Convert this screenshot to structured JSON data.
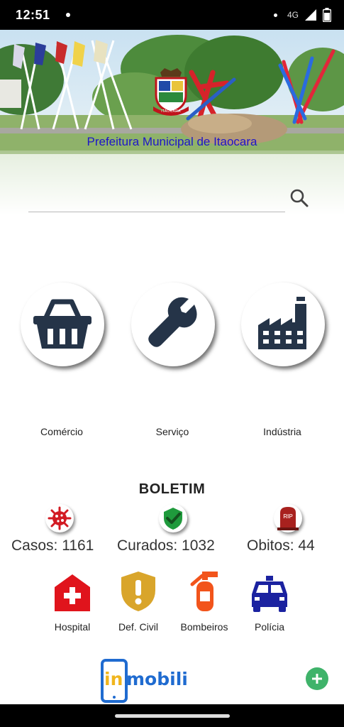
{
  "status": {
    "time": "12:51",
    "network": "4G"
  },
  "header": {
    "title": "Prefeitura Municipal de Itaocara",
    "seal_text": "ITAOCARA"
  },
  "search": {
    "placeholder": ""
  },
  "categories": [
    {
      "label": "Comércio",
      "icon": "basket-icon"
    },
    {
      "label": "Serviço",
      "icon": "wrench-icon"
    },
    {
      "label": "Indústria",
      "icon": "factory-icon"
    }
  ],
  "boletim": {
    "title": "BOLETIM",
    "casos": "Casos: 1161",
    "curados": "Curados: 1032",
    "obitos": "Obitos: 44",
    "rip_text": "RIP"
  },
  "services": [
    {
      "label": "Hospital",
      "icon": "hospital-icon"
    },
    {
      "label": "Def. Civil",
      "icon": "shield-alert-icon"
    },
    {
      "label": "Bombeiros",
      "icon": "fire-extinguisher-icon"
    },
    {
      "label": "Polícia",
      "icon": "police-car-icon"
    }
  ],
  "footer": {
    "logo_text_in": "in",
    "logo_text_mobili": "mobili"
  },
  "colors": {
    "icon_dark": "#253448",
    "title_blue": "#1d16c8",
    "red": "#e0141c",
    "gold": "#d9a52b",
    "orange": "#f2541b",
    "navy": "#1b22a0",
    "fab_green": "#3fb36a"
  }
}
